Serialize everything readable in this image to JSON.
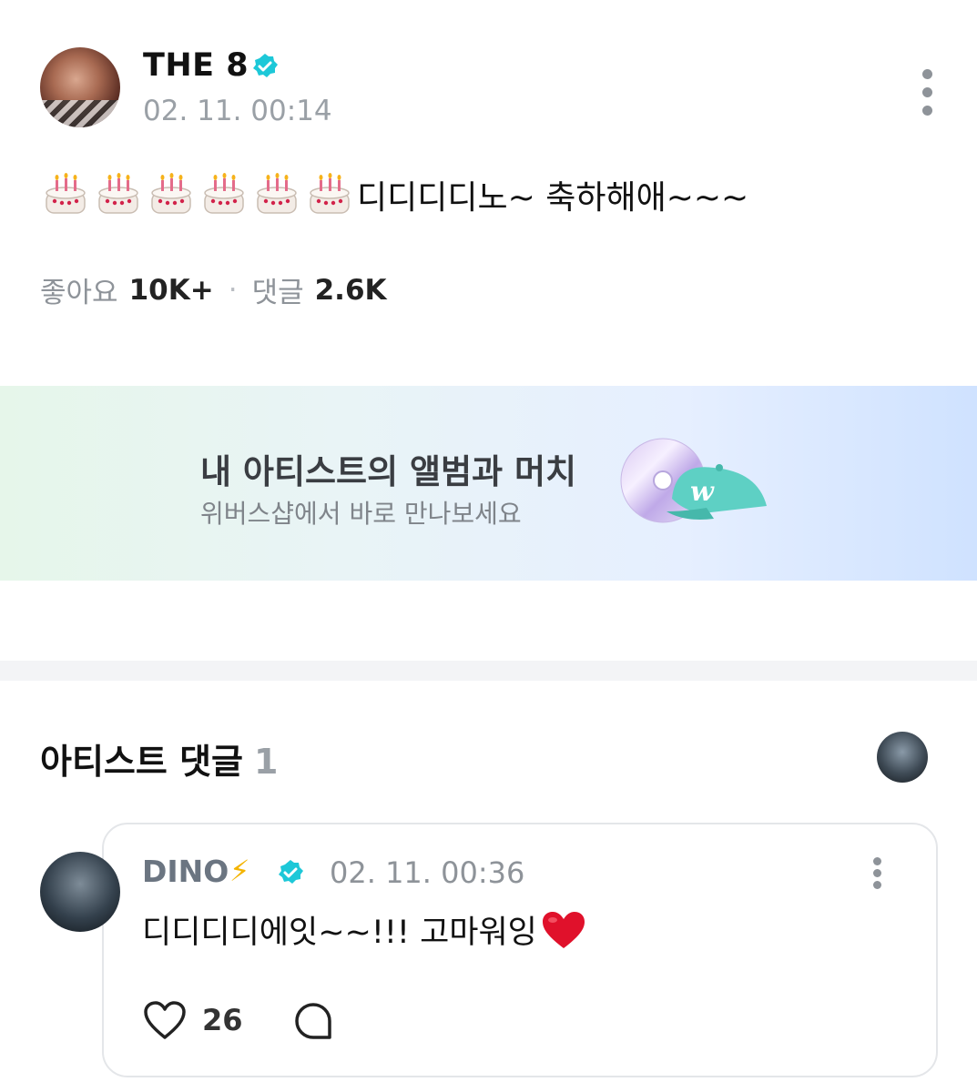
{
  "post": {
    "author": "THE 8",
    "date": "02. 11. 00:14",
    "cake_count": 6,
    "text": "디디디디노~ 축하해애~~~",
    "stats": {
      "likes_label": "좋아요",
      "likes_value": "10K+",
      "separator": "·",
      "comments_label": "댓글",
      "comments_value": "2.6K"
    }
  },
  "banner": {
    "title": "내 아티스트의 앨범과 머치",
    "subtitle": "위버스샵에서 바로 만나보세요",
    "cap_logo": "w"
  },
  "artist_comments": {
    "title": "아티스트 댓글",
    "count": "1",
    "comment": {
      "author": "DINO",
      "bolt": "⚡",
      "date": "02. 11. 00:36",
      "text": "디디디디에잇~~!!! 고마워잉",
      "likes": "26"
    }
  },
  "colors": {
    "verified": "#1dc8d8",
    "heart": "#e0112b",
    "bolt": "#f4b400"
  }
}
